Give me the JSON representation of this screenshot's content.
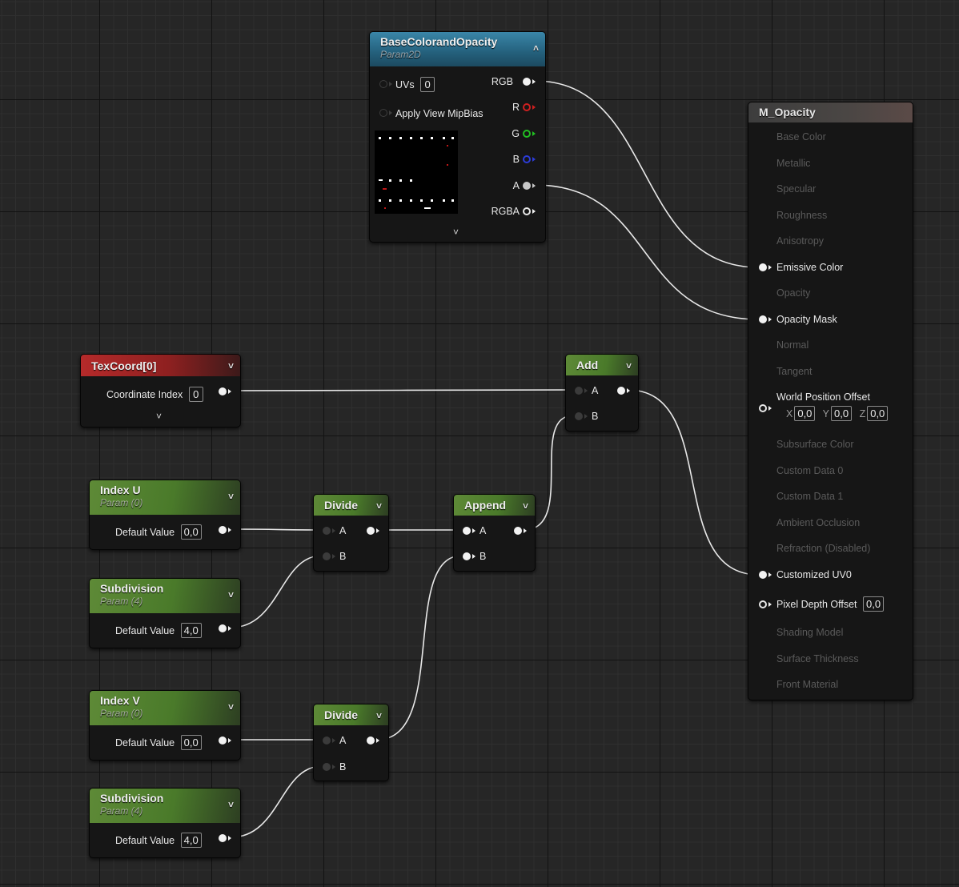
{
  "nodes": {
    "base_color": {
      "title": "BaseColorandOpacity",
      "subtitle": "Param2D",
      "uvs_label": "UVs",
      "uvs_value": "0",
      "mipbias_label": "Apply View MipBias",
      "outputs": [
        "RGB",
        "R",
        "G",
        "B",
        "A",
        "RGBA"
      ]
    },
    "material": {
      "title": "M_Opacity",
      "inputs": {
        "base_color": "Base Color",
        "metallic": "Metallic",
        "specular": "Specular",
        "roughness": "Roughness",
        "anisotropy": "Anisotropy",
        "emissive": "Emissive Color",
        "opacity": "Opacity",
        "opacity_mask": "Opacity Mask",
        "normal": "Normal",
        "tangent": "Tangent",
        "wpo": "World Position Offset",
        "subsurface": "Subsurface Color",
        "custom0": "Custom Data 0",
        "custom1": "Custom Data 1",
        "ao": "Ambient Occlusion",
        "refraction": "Refraction (Disabled)",
        "customized_uv0": "Customized UV0",
        "pdo": "Pixel Depth Offset",
        "shading_model": "Shading Model",
        "surface_thickness": "Surface Thickness",
        "front_material": "Front Material"
      },
      "wpo_x_label": "X",
      "wpo_x": "0,0",
      "wpo_y_label": "Y",
      "wpo_y": "0,0",
      "wpo_z_label": "Z",
      "wpo_z": "0,0",
      "pdo_value": "0,0"
    },
    "texcoord": {
      "title": "TexCoord[0]",
      "label": "Coordinate Index",
      "value": "0"
    },
    "add": {
      "title": "Add",
      "in_a": "A",
      "in_b": "B"
    },
    "index_u": {
      "title": "Index U",
      "subtitle": "Param (0)",
      "label": "Default Value",
      "value": "0,0"
    },
    "subdiv_1": {
      "title": "Subdivision",
      "subtitle": "Param (4)",
      "label": "Default Value",
      "value": "4,0"
    },
    "index_v": {
      "title": "Index V",
      "subtitle": "Param (0)",
      "label": "Default Value",
      "value": "0,0"
    },
    "subdiv_2": {
      "title": "Subdivision",
      "subtitle": "Param (4)",
      "label": "Default Value",
      "value": "4,0"
    },
    "divide_1": {
      "title": "Divide",
      "in_a": "A",
      "in_b": "B"
    },
    "divide_2": {
      "title": "Divide",
      "in_a": "A",
      "in_b": "B"
    },
    "append": {
      "title": "Append",
      "in_a": "A",
      "in_b": "B"
    }
  },
  "icons": {
    "collapse": "chevron-up-icon",
    "expand": "chevron-down-icon",
    "pin": "pin-circle-icon"
  },
  "colors": {
    "grid_bg": "#262626",
    "wire": "#e8e8e8",
    "param_header": "#4a7a2a",
    "texture_header": "#24607c",
    "texcoord_header": "#8e2020"
  }
}
